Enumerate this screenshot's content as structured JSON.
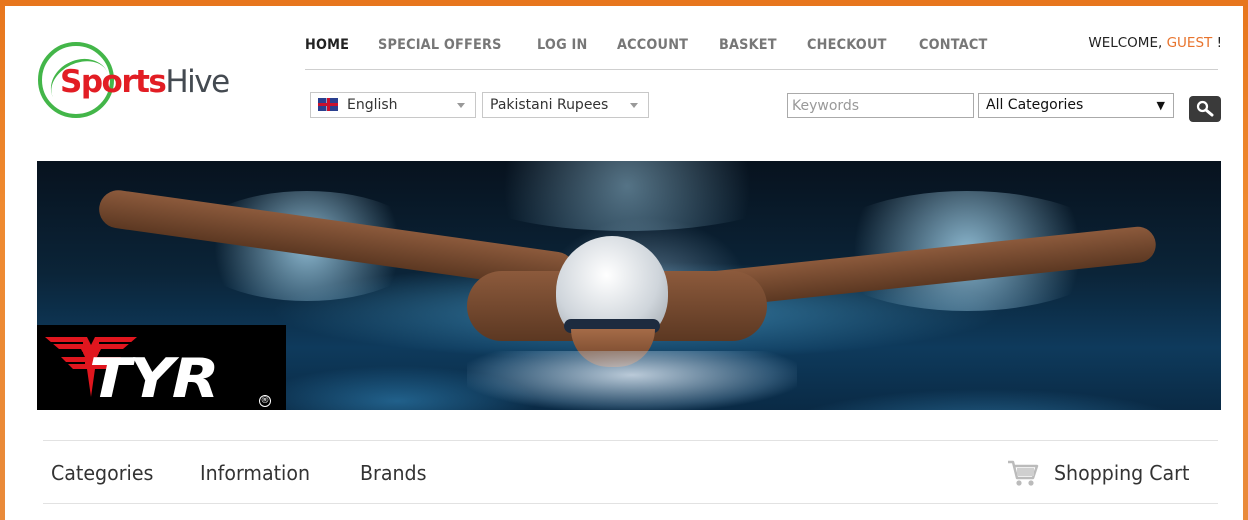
{
  "brand": {
    "logo_part1": "Sports",
    "logo_part2": "Hive"
  },
  "top_nav": [
    {
      "label": "HOME",
      "active": true
    },
    {
      "label": "SPECIAL OFFERS",
      "active": false
    },
    {
      "label": "LOG IN",
      "active": false
    },
    {
      "label": "ACCOUNT",
      "active": false
    },
    {
      "label": "BASKET",
      "active": false
    },
    {
      "label": "CHECKOUT",
      "active": false
    },
    {
      "label": "CONTACT",
      "active": false
    }
  ],
  "welcome": {
    "prefix": "WELCOME,",
    "user": "GUEST",
    "suffix": "!"
  },
  "language": {
    "selected": "English",
    "icon": "uk-flag-icon"
  },
  "currency": {
    "selected": "Pakistani Rupees"
  },
  "search": {
    "placeholder": "Keywords",
    "category_selected": "All Categories",
    "button_icon": "magnifier-icon"
  },
  "banner": {
    "brand_logo_text": "TYR",
    "description": "swimmer-butterfly-stroke"
  },
  "bottom_nav": {
    "categories": "Categories",
    "information": "Information",
    "brands": "Brands",
    "cart": "Shopping Cart",
    "cart_icon": "shopping-cart-icon"
  },
  "colors": {
    "accent": "#e8732c",
    "logo_red": "#e21d24",
    "logo_green": "#43b649",
    "background_orange": "#e7761d"
  }
}
